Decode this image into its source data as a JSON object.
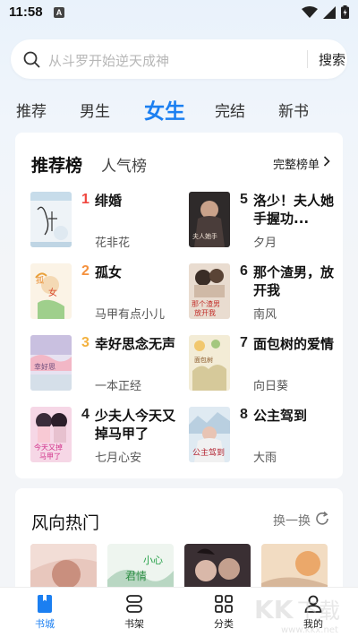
{
  "status_bar": {
    "time": "11:58",
    "notification_badge": "A"
  },
  "search": {
    "placeholder": "从斗罗开始逆天成神",
    "button": "搜索"
  },
  "tabs": [
    "推荐",
    "男生",
    "女生",
    "完结",
    "新书"
  ],
  "active_tab": "女生",
  "ranking": {
    "tab_active": "推荐榜",
    "tab_other": "人气榜",
    "full_list": "完整榜单",
    "books": [
      {
        "rank": "1",
        "title": "绯婚",
        "author": "花非花"
      },
      {
        "rank": "2",
        "title": "孤女",
        "author": "马甲有点小儿"
      },
      {
        "rank": "3",
        "title": "幸好思念无声",
        "author": "一本正经"
      },
      {
        "rank": "4",
        "title": "少夫人今天又掉马甲了",
        "author": "七月心安"
      },
      {
        "rank": "5",
        "title": "洛少！夫人她手握功...",
        "author": "夕月"
      },
      {
        "rank": "6",
        "title": "那个渣男，放开我",
        "author": "南风"
      },
      {
        "rank": "7",
        "title": "面包树的爱情",
        "author": "向日葵"
      },
      {
        "rank": "8",
        "title": "公主驾到",
        "author": "大雨"
      }
    ],
    "rank_colors": {
      "1": "#f0473f",
      "2": "#f5913d",
      "3": "#f3b13e",
      "other": "#222222"
    }
  },
  "trending": {
    "title": "风向热门",
    "refresh": "换一换"
  },
  "bottom_nav": [
    {
      "label": "书城",
      "icon": "bookstore-icon"
    },
    {
      "label": "书架",
      "icon": "bookshelf-icon"
    },
    {
      "label": "分类",
      "icon": "category-grid-icon"
    },
    {
      "label": "我的",
      "icon": "profile-icon"
    }
  ],
  "accent_color": "#1b7ff1",
  "watermark": "KK下载 www.kkx.net"
}
